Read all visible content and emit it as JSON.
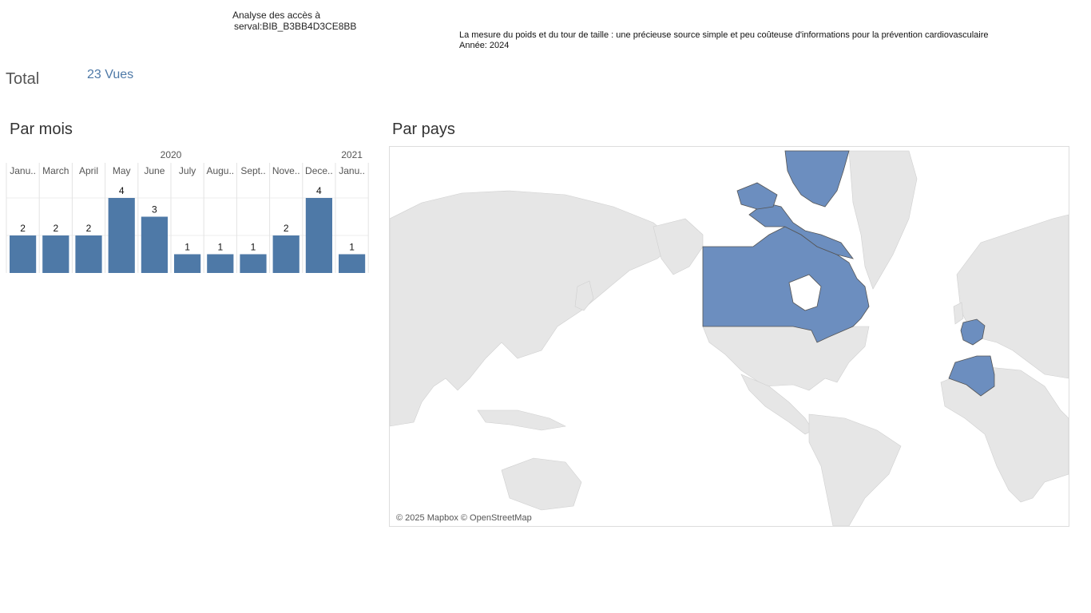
{
  "header": {
    "title_line1": "Analyse des accès à",
    "title_line2": "serval:BIB_B3BB4D3CE8BB",
    "subtitle_line1": "La mesure du poids et du tour de taille : une précieuse source simple et peu coûteuse d'informations pour la prévention cardiovasculaire",
    "subtitle_line2": "Année: 2024"
  },
  "total": {
    "label": "Total",
    "value": "23 Vues"
  },
  "sections": {
    "by_month": "Par mois",
    "by_country": "Par pays"
  },
  "map": {
    "credit": "© 2025 Mapbox © OpenStreetMap",
    "highlighted_countries": [
      "Canada",
      "France",
      "Algeria"
    ],
    "highlight_color": "#6c8ebf",
    "base_color": "#e6e6e6"
  },
  "chart_data": {
    "type": "bar",
    "years": [
      {
        "label": "2020",
        "span": 10
      },
      {
        "label": "2021",
        "span": 1
      }
    ],
    "categories": [
      "Janu..",
      "March",
      "April",
      "May",
      "June",
      "July",
      "Augu..",
      "Sept..",
      "Nove..",
      "Dece..",
      "Janu.."
    ],
    "values": [
      2,
      2,
      2,
      4,
      3,
      1,
      1,
      1,
      2,
      4,
      1
    ],
    "ylim": [
      0,
      4
    ],
    "bar_color": "#4e79a7",
    "grid": true
  }
}
